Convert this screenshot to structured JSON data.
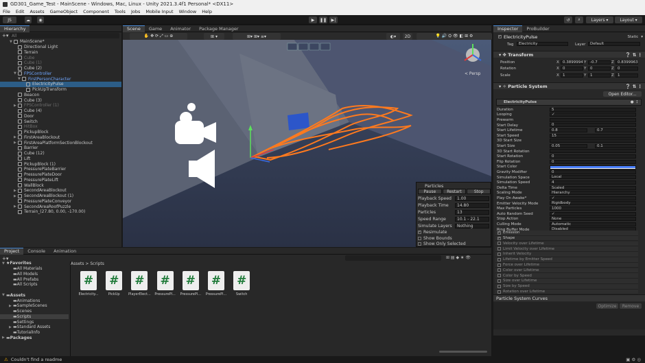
{
  "window": {
    "title": "GD301_Game_Test - MainScene - Windows, Mac, Linux - Unity 2021.3.4f1 Personal* <DX11>"
  },
  "menu": [
    "File",
    "Edit",
    "Assets",
    "GameObject",
    "Component",
    "Tools",
    "Jobs",
    "Mobile Input",
    "Window",
    "Help"
  ],
  "toolbar": {
    "account": "JS",
    "layers": "Layers",
    "layout": "Layout"
  },
  "hierarchy": {
    "tab": "Hierarchy",
    "search_placeholder": "All",
    "items": [
      {
        "label": "MainScene*",
        "indent": 0,
        "arrow": "▼",
        "icon": "scene"
      },
      {
        "label": "Directional Light",
        "indent": 1
      },
      {
        "label": "Terrain",
        "indent": 1
      },
      {
        "label": "Cube",
        "indent": 1,
        "dim": true
      },
      {
        "label": "Cube (1)",
        "indent": 1,
        "dim": true
      },
      {
        "label": "Cube (2)",
        "indent": 1
      },
      {
        "label": "FPSController",
        "indent": 1,
        "arrow": "▼",
        "blue": true
      },
      {
        "label": "FirstPersonCharacter",
        "indent": 2,
        "arrow": "▼",
        "blue": true
      },
      {
        "label": "ElectricityPulse",
        "indent": 3,
        "sel": true
      },
      {
        "label": "PickUpTransform",
        "indent": 3
      },
      {
        "label": "Beacon",
        "indent": 1
      },
      {
        "label": "Cube (3)",
        "indent": 1
      },
      {
        "label": "FPSController (1)",
        "indent": 1,
        "arrow": "▶",
        "dim": true
      },
      {
        "label": "Cube (4)",
        "indent": 1
      },
      {
        "label": "Door",
        "indent": 1
      },
      {
        "label": "Switch",
        "indent": 1
      },
      {
        "label": "HitBox",
        "indent": 1,
        "dim": true
      },
      {
        "label": "PickupBlock",
        "indent": 1
      },
      {
        "label": "FirstAreaBlockout",
        "indent": 1,
        "arrow": "▶"
      },
      {
        "label": "FirstAreaPlatformSectionBlockout",
        "indent": 1,
        "arrow": "▶"
      },
      {
        "label": "Barrier",
        "indent": 1
      },
      {
        "label": "Cube (12)",
        "indent": 1
      },
      {
        "label": "Lift",
        "indent": 1
      },
      {
        "label": "PickupBlock (1)",
        "indent": 1
      },
      {
        "label": "PressurePlateBarrier",
        "indent": 1
      },
      {
        "label": "PressurePlateDoor",
        "indent": 1
      },
      {
        "label": "PressurePlateLift",
        "indent": 1
      },
      {
        "label": "WallBlock",
        "indent": 1
      },
      {
        "label": "SecondAreaBlockout",
        "indent": 1,
        "arrow": "▶"
      },
      {
        "label": "SecondAreaBlockout (1)",
        "indent": 1,
        "arrow": "▶"
      },
      {
        "label": "PressurePlateConveyor",
        "indent": 1
      },
      {
        "label": "SecondAreaRoofPuzzle",
        "indent": 1,
        "arrow": "▶"
      },
      {
        "label": "Terrain_(27.80, 0.00, -170.00)",
        "indent": 1
      }
    ]
  },
  "scene": {
    "tabs": [
      "Scene",
      "Game",
      "Animator",
      "Package Manager"
    ],
    "view_mode": "2D",
    "persp": "< Persp"
  },
  "particles_overlay": {
    "title": "Particles",
    "buttons": [
      "Pause",
      "Restart",
      "Stop"
    ],
    "rows": [
      {
        "label": "Playback Speed",
        "value": "1.00"
      },
      {
        "label": "Playback Time",
        "value": "14.80"
      },
      {
        "label": "Particles",
        "value": "13"
      },
      {
        "label": "Speed Range",
        "value": "10.1 - 22.1"
      },
      {
        "label": "Simulate Layers",
        "value": "Nothing"
      }
    ],
    "checks": [
      {
        "label": "Resimulate",
        "checked": true
      },
      {
        "label": "Show Bounds",
        "checked": false
      },
      {
        "label": "Show Only Selected",
        "checked": false
      }
    ]
  },
  "inspector": {
    "tabs": [
      "Inspector",
      "ProBuilder"
    ],
    "object_name": "ElectricityPulse",
    "static_label": "Static",
    "tag_label": "Tag",
    "tag_value": "Electricity",
    "layer_label": "Layer",
    "layer_value": "Default",
    "transform": {
      "title": "Transform",
      "rows": [
        {
          "label": "Position",
          "x": "0.3899994",
          "y": "-0.7",
          "z": "0.8399963"
        },
        {
          "label": "Rotation",
          "x": "0",
          "y": "0",
          "z": "0"
        },
        {
          "label": "Scale",
          "x": "1",
          "y": "1",
          "z": "1"
        }
      ]
    },
    "ps": {
      "title": "Particle System",
      "open_editor": "Open Editor...",
      "header": "ElectricityPulse",
      "props": [
        {
          "label": "Duration",
          "value": "5"
        },
        {
          "label": "Looping",
          "value": "✓"
        },
        {
          "label": "Prewarm",
          "value": ""
        },
        {
          "label": "Start Delay",
          "value": "0"
        },
        {
          "label": "Start Lifetime",
          "value": "0.8",
          "value2": "0.7"
        },
        {
          "label": "Start Speed",
          "value": "15"
        },
        {
          "label": "3D Start Size",
          "value": ""
        },
        {
          "label": "Start Size",
          "value": "0.05",
          "value2": "0.1"
        },
        {
          "label": "3D Start Rotation",
          "value": ""
        },
        {
          "label": "Start Rotation",
          "value": "0"
        },
        {
          "label": "Flip Rotation",
          "value": "0"
        },
        {
          "label": "Start Color",
          "value": ""
        },
        {
          "label": "Gravity Modifier",
          "value": "0"
        },
        {
          "label": "Simulation Space",
          "value": "Local"
        },
        {
          "label": "Simulation Speed",
          "value": "4"
        },
        {
          "label": "Delta Time",
          "value": "Scaled"
        },
        {
          "label": "Scaling Mode",
          "value": "Hierarchy"
        },
        {
          "label": "Play On Awake*",
          "value": "✓"
        },
        {
          "label": "Emitter Velocity Mode",
          "value": "Rigidbody"
        },
        {
          "label": "Max Particles",
          "value": "1000"
        },
        {
          "label": "Auto Random Seed",
          "value": "✓"
        },
        {
          "label": "Stop Action",
          "value": "None"
        },
        {
          "label": "Culling Mode",
          "value": "Automatic"
        },
        {
          "label": "Ring Buffer Mode",
          "value": "Disabled"
        }
      ],
      "modules": [
        {
          "label": "Emission",
          "on": true
        },
        {
          "label": "Shape",
          "on": true
        },
        {
          "label": "Velocity over Lifetime",
          "on": false
        },
        {
          "label": "Limit Velocity over Lifetime",
          "on": false
        },
        {
          "label": "Inherit Velocity",
          "on": false
        },
        {
          "label": "Lifetime by Emitter Speed",
          "on": false
        },
        {
          "label": "Force over Lifetime",
          "on": false
        },
        {
          "label": "Color over Lifetime",
          "on": false
        },
        {
          "label": "Color by Speed",
          "on": false
        },
        {
          "label": "Size over Lifetime",
          "on": false
        },
        {
          "label": "Size by Speed",
          "on": false
        },
        {
          "label": "Rotation over Lifetime",
          "on": false
        }
      ],
      "curves": "Particle System Curves",
      "optimize": "Optimize",
      "remove": "Remove"
    }
  },
  "project": {
    "tabs": [
      "Project",
      "Console",
      "Animation"
    ],
    "breadcrumb": "Assets  >  Scripts",
    "tree": [
      {
        "label": "Favorites",
        "indent": 0,
        "arrow": "▼",
        "bold": true
      },
      {
        "label": "All Materials",
        "indent": 1
      },
      {
        "label": "All Models",
        "indent": 1
      },
      {
        "label": "All Prefabs",
        "indent": 1
      },
      {
        "label": "All Scripts",
        "indent": 1
      },
      {
        "label": "",
        "indent": 0
      },
      {
        "label": "Assets",
        "indent": 0,
        "arrow": "▼",
        "bold": true
      },
      {
        "label": "Animations",
        "indent": 1
      },
      {
        "label": "SampleScenes",
        "indent": 1,
        "arrow": "▶"
      },
      {
        "label": "Scenes",
        "indent": 1
      },
      {
        "label": "Scripts",
        "indent": 1,
        "sel": true
      },
      {
        "label": "Settings",
        "indent": 1
      },
      {
        "label": "Standard Assets",
        "indent": 1,
        "arrow": "▶"
      },
      {
        "label": "TutorialInfo",
        "indent": 1
      },
      {
        "label": "Packages",
        "indent": 0,
        "arrow": "▶",
        "bold": true
      }
    ],
    "assets": [
      "Electricity...",
      "PickUp",
      "PlayerElect...",
      "PressurePl...",
      "PressurePl...",
      "PressurePl...",
      "Switch"
    ]
  },
  "status": "Couldn't find a readme"
}
